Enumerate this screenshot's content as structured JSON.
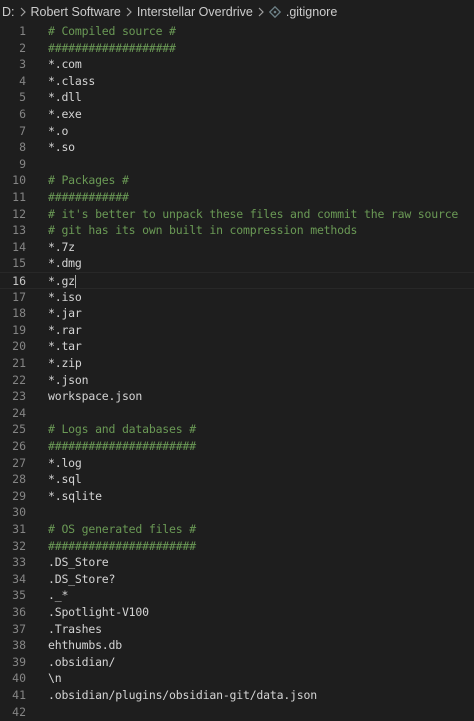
{
  "breadcrumb": {
    "drive": "D:",
    "folder1": "Robert Software",
    "folder2": "Interstellar Overdrive",
    "file": ".gitignore"
  },
  "icons": {
    "separator": "chevron-right-icon",
    "file": "git-file-icon"
  },
  "colors": {
    "background": "#1e1e1e",
    "comment": "#6a9955",
    "text": "#d4d4d4",
    "line_number": "#858585",
    "active_line_number": "#c6c6c6",
    "file_icon": "#6d8086"
  },
  "editor": {
    "current_line": 16,
    "lines": [
      {
        "n": "1",
        "text": "# Compiled source #",
        "type": "comment"
      },
      {
        "n": "2",
        "text": "###################",
        "type": "comment"
      },
      {
        "n": "3",
        "text": "*.com",
        "type": "plain"
      },
      {
        "n": "4",
        "text": "*.class",
        "type": "plain"
      },
      {
        "n": "5",
        "text": "*.dll",
        "type": "plain"
      },
      {
        "n": "6",
        "text": "*.exe",
        "type": "plain"
      },
      {
        "n": "7",
        "text": "*.o",
        "type": "plain"
      },
      {
        "n": "8",
        "text": "*.so",
        "type": "plain"
      },
      {
        "n": "9",
        "text": "",
        "type": "plain"
      },
      {
        "n": "10",
        "text": "# Packages #",
        "type": "comment"
      },
      {
        "n": "11",
        "text": "############",
        "type": "comment"
      },
      {
        "n": "12",
        "text": "# it's better to unpack these files and commit the raw source",
        "type": "comment"
      },
      {
        "n": "13",
        "text": "# git has its own built in compression methods",
        "type": "comment"
      },
      {
        "n": "14",
        "text": "*.7z",
        "type": "plain"
      },
      {
        "n": "15",
        "text": "*.dmg",
        "type": "plain"
      },
      {
        "n": "16",
        "text": "*.gz",
        "type": "plain"
      },
      {
        "n": "17",
        "text": "*.iso",
        "type": "plain"
      },
      {
        "n": "18",
        "text": "*.jar",
        "type": "plain"
      },
      {
        "n": "19",
        "text": "*.rar",
        "type": "plain"
      },
      {
        "n": "20",
        "text": "*.tar",
        "type": "plain"
      },
      {
        "n": "21",
        "text": "*.zip",
        "type": "plain"
      },
      {
        "n": "22",
        "text": "*.json",
        "type": "plain"
      },
      {
        "n": "23",
        "text": "workspace.json",
        "type": "plain"
      },
      {
        "n": "24",
        "text": "",
        "type": "plain"
      },
      {
        "n": "25",
        "text": "# Logs and databases #",
        "type": "comment"
      },
      {
        "n": "26",
        "text": "######################",
        "type": "comment"
      },
      {
        "n": "27",
        "text": "*.log",
        "type": "plain"
      },
      {
        "n": "28",
        "text": "*.sql",
        "type": "plain"
      },
      {
        "n": "29",
        "text": "*.sqlite",
        "type": "plain"
      },
      {
        "n": "30",
        "text": "",
        "type": "plain"
      },
      {
        "n": "31",
        "text": "# OS generated files #",
        "type": "comment"
      },
      {
        "n": "32",
        "text": "######################",
        "type": "comment"
      },
      {
        "n": "33",
        "text": ".DS_Store",
        "type": "plain"
      },
      {
        "n": "34",
        "text": ".DS_Store?",
        "type": "plain"
      },
      {
        "n": "35",
        "text": "._*",
        "type": "plain"
      },
      {
        "n": "36",
        "text": ".Spotlight-V100",
        "type": "plain"
      },
      {
        "n": "37",
        "text": ".Trashes",
        "type": "plain"
      },
      {
        "n": "38",
        "text": "ehthumbs.db",
        "type": "plain"
      },
      {
        "n": "39",
        "text": ".obsidian/",
        "type": "plain"
      },
      {
        "n": "40",
        "text": "\\n",
        "type": "plain"
      },
      {
        "n": "41",
        "text": ".obsidian/plugins/obsidian-git/data.json",
        "type": "plain"
      },
      {
        "n": "42",
        "text": "",
        "type": "plain"
      }
    ]
  }
}
